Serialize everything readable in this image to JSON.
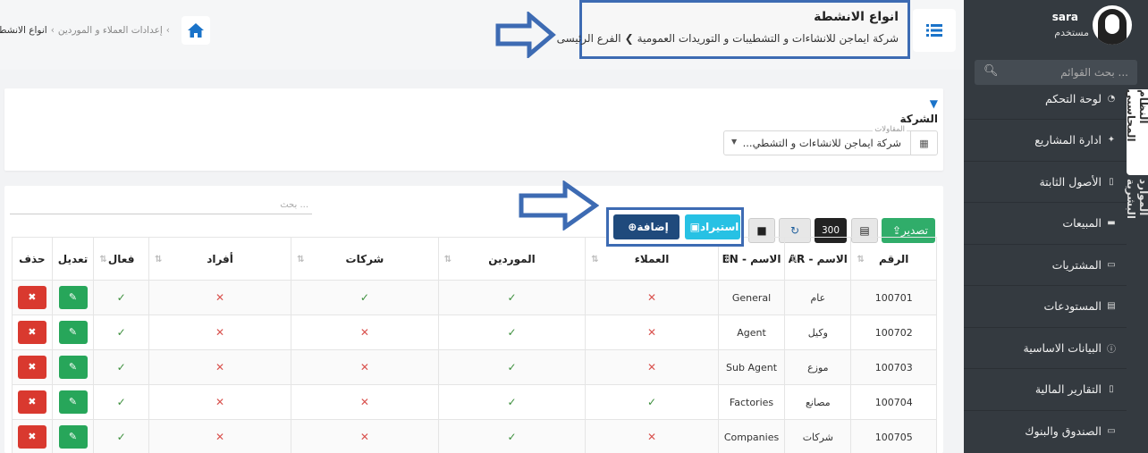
{
  "sidebar": {
    "user_name": "sara",
    "user_role": "مستخدم",
    "search_placeholder": "بحث القوائم ...",
    "items": [
      {
        "label": "لوحة التحكم",
        "icon": "dashboard-icon"
      },
      {
        "label": "ادارة المشاريع",
        "icon": "handshake-icon"
      },
      {
        "label": "الأصول الثابتة",
        "icon": "file-icon"
      },
      {
        "label": "المبيعات",
        "icon": "truck-icon"
      },
      {
        "label": "المشتريات",
        "icon": "money-icon"
      },
      {
        "label": "المستودعات",
        "icon": "archive-icon"
      },
      {
        "label": "البيانات الاساسية",
        "icon": "info-icon"
      },
      {
        "label": "التقارير المالية",
        "icon": "file-icon"
      },
      {
        "label": "الصندوق والبنوك",
        "icon": "money-icon"
      }
    ],
    "vertical_tabs": [
      "النظام المحاسبي",
      "الموارد البشرية"
    ]
  },
  "header": {
    "title": "انواع الانشطة",
    "company": "شركة ايماجن للانشاءات و التشطيبات و التوريدات العمومية",
    "branch": "الفرع الرئيسى",
    "breadcrumb": [
      "إعدادات العملاء و الموردين",
      "انواع الانشطة"
    ]
  },
  "filter": {
    "label": "الشركة",
    "field_label": "المقاولات",
    "value": "شركة ايماجن للانشاءات و التشطي..."
  },
  "toolbar": {
    "export": "تصدير",
    "page_size": "300",
    "import": "استيراد",
    "add": "إضافة",
    "search_placeholder": "بحث ..."
  },
  "table": {
    "headers": [
      "الرقم",
      "الاسم - AR",
      "الاسم - EN",
      "العملاء",
      "الموردين",
      "شركات",
      "أفراد",
      "فعال",
      "تعديل",
      "حذف"
    ],
    "rows": [
      {
        "id": "100701",
        "ar": "عام",
        "en": "General",
        "customers": false,
        "suppliers": true,
        "companies": true,
        "individuals": false,
        "active": true
      },
      {
        "id": "100702",
        "ar": "وكيل",
        "en": "Agent",
        "customers": false,
        "suppliers": true,
        "companies": false,
        "individuals": false,
        "active": true
      },
      {
        "id": "100703",
        "ar": "موزع",
        "en": "Sub Agent",
        "customers": false,
        "suppliers": true,
        "companies": false,
        "individuals": false,
        "active": true
      },
      {
        "id": "100704",
        "ar": "مصانع",
        "en": "Factories",
        "customers": true,
        "suppliers": true,
        "companies": false,
        "individuals": false,
        "active": true
      },
      {
        "id": "100705",
        "ar": "شركات",
        "en": "Companies",
        "customers": false,
        "suppliers": true,
        "companies": false,
        "individuals": false,
        "active": true
      }
    ]
  },
  "colors": {
    "sidebar_bg": "#343a40",
    "primary": "#1a73c9",
    "export_green": "#30ad6a",
    "import_cyan": "#27c1e4",
    "add_navy": "#1f4a7c",
    "delete_red": "#d9392f",
    "highlight_border": "#3d6bb3"
  }
}
